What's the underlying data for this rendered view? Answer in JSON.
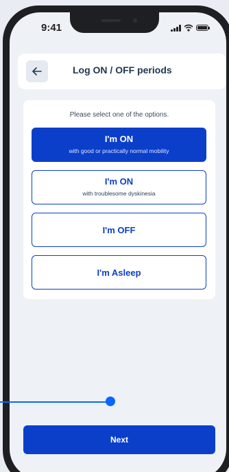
{
  "status": {
    "time": "9:41"
  },
  "header": {
    "title": "Log ON / OFF periods",
    "back_icon": "arrow-left-icon"
  },
  "prompt": "Please select one of the options.",
  "options": [
    {
      "title": "I'm ON",
      "subtitle": "with good or practically normal mobility",
      "selected": true
    },
    {
      "title": "I'm ON",
      "subtitle": "with troublesome dyskinesia",
      "selected": false
    },
    {
      "title": "I'm OFF",
      "subtitle": "",
      "selected": false
    },
    {
      "title": "I'm Asleep",
      "subtitle": "",
      "selected": false
    }
  ],
  "next_label": "Next",
  "colors": {
    "accent": "#0b3fca",
    "slider": "#0a66ff",
    "background": "#eef1f6"
  }
}
